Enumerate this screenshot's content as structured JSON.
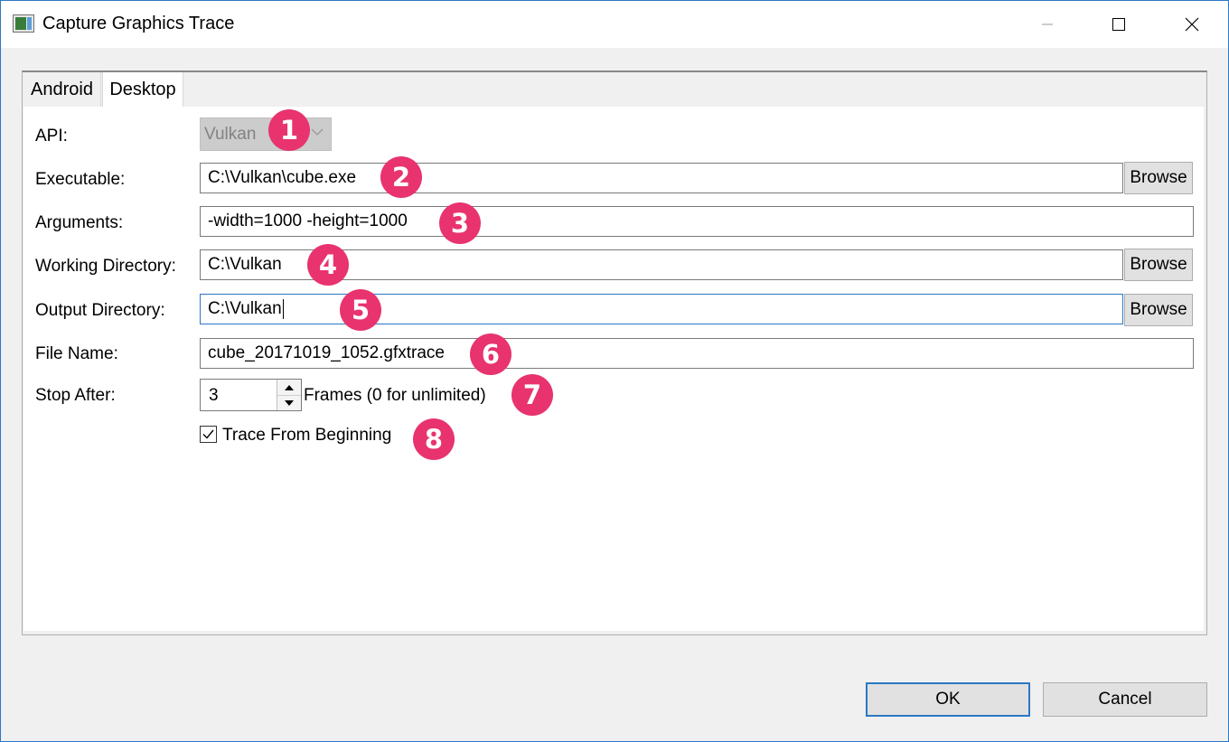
{
  "window": {
    "title": "Capture Graphics Trace",
    "controls": {
      "minimize": "minimize-icon",
      "maximize": "maximize-icon",
      "close": "close-icon"
    }
  },
  "tabs": [
    {
      "label": "Android",
      "selected": false
    },
    {
      "label": "Desktop",
      "selected": true
    }
  ],
  "form": {
    "api": {
      "label": "API:",
      "value": "Vulkan",
      "enabled": false
    },
    "executable": {
      "label": "Executable:",
      "value": "C:\\Vulkan\\cube.exe",
      "browse": "Browse"
    },
    "arguments": {
      "label": "Arguments:",
      "value": "-width=1000 -height=1000"
    },
    "working_directory": {
      "label": "Working Directory:",
      "value": "C:\\Vulkan",
      "browse": "Browse"
    },
    "output_directory": {
      "label": "Output Directory:",
      "value": "C:\\Vulkan",
      "browse": "Browse"
    },
    "file_name": {
      "label": "File Name:",
      "value": "cube_20171019_1052.gfxtrace"
    },
    "stop_after": {
      "label": "Stop After:",
      "value": "3",
      "suffix": "Frames (0 for unlimited)"
    },
    "trace_from_beginning": {
      "label": "Trace From Beginning",
      "checked": true
    }
  },
  "annotations": [
    "1",
    "2",
    "3",
    "4",
    "5",
    "6",
    "7",
    "8"
  ],
  "buttons": {
    "ok": "OK",
    "cancel": "Cancel"
  },
  "colors": {
    "accent": "#2b78c4",
    "badge": "#e8336f",
    "disabled_combo": "#cccccc"
  }
}
